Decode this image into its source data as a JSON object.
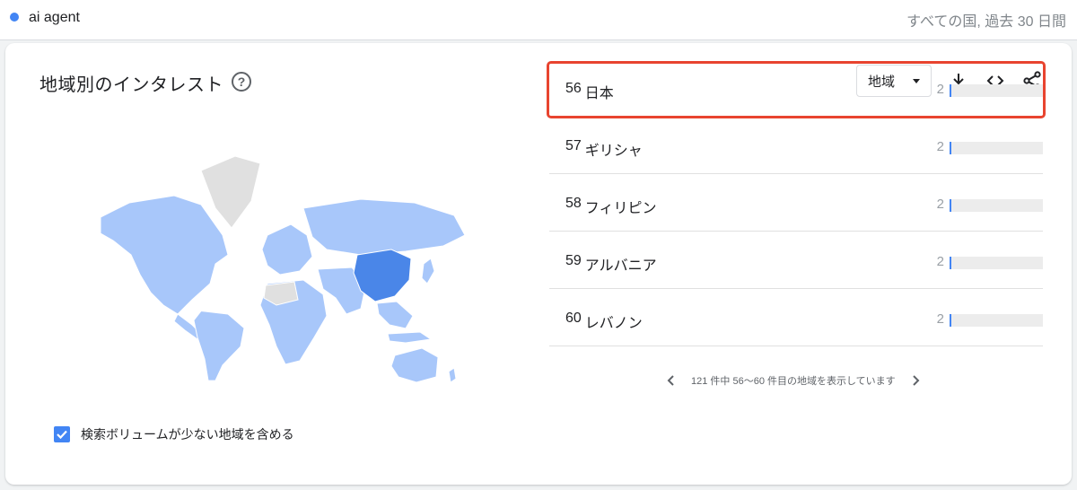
{
  "search": {
    "term": "ai agent",
    "scope": "すべての国, 過去 30 日間",
    "term_color": "#4285f4"
  },
  "card": {
    "title": "地域別のインタレスト",
    "dropdown_value": "地域",
    "toolbar_icons": [
      "download-icon",
      "embed-icon",
      "share-icon"
    ],
    "include_low_volume_label": "検索ボリュームが少ない地域を含める",
    "include_low_volume_checked": true
  },
  "regions": [
    {
      "rank": "56",
      "name": "日本",
      "value": "2",
      "fraction": 0.02
    },
    {
      "rank": "57",
      "name": "ギリシャ",
      "value": "2",
      "fraction": 0.02
    },
    {
      "rank": "58",
      "name": "フィリピン",
      "value": "2",
      "fraction": 0.02
    },
    {
      "rank": "59",
      "name": "アルバニア",
      "value": "2",
      "fraction": 0.02
    },
    {
      "rank": "60",
      "name": "レバノン",
      "value": "2",
      "fraction": 0.02
    }
  ],
  "highlighted_region_rank": "56",
  "pager": {
    "text": "121 件中 56〜60 件目の地域を表示しています"
  },
  "colors": {
    "accent": "#4285f4",
    "highlight_border": "#e8442f",
    "map_light": "#a8c7fa",
    "map_dark": "#4a86e8",
    "map_none": "#e0e0e0"
  }
}
